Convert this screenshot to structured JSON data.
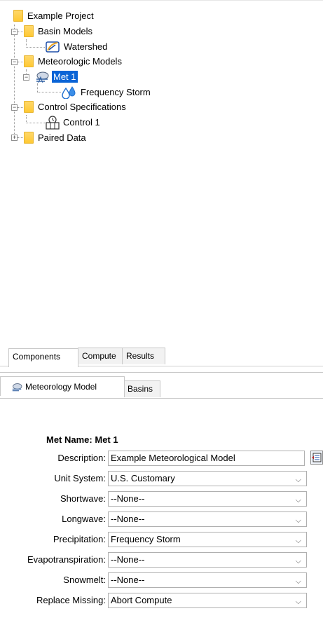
{
  "tree": {
    "root": "Example Project",
    "basin_models": "Basin Models",
    "watershed": "Watershed",
    "meteorologic_models": "Meteorologic Models",
    "met1": "Met 1",
    "frequency_storm": "Frequency Storm",
    "control_specs": "Control Specifications",
    "control1": "Control 1",
    "paired_data": "Paired Data",
    "expand_minus": "−",
    "expand_plus": "+"
  },
  "bottom_tabs": [
    "Components",
    "Compute",
    "Results"
  ],
  "detail_tabs": [
    "Meteorology Model",
    "Basins"
  ],
  "form": {
    "met_name_label": "Met Name:",
    "met_name_value": "Met 1",
    "fields": [
      {
        "label": "Description:",
        "value": "Example Meteorological Model"
      },
      {
        "label": "Unit System:",
        "value": "U.S. Customary"
      },
      {
        "label": "Shortwave:",
        "value": "--None--"
      },
      {
        "label": "Longwave:",
        "value": "--None--"
      },
      {
        "label": "Precipitation:",
        "value": "Frequency Storm"
      },
      {
        "label": "Evapotranspiration:",
        "value": "--None--"
      },
      {
        "label": "Snowmelt:",
        "value": "--None--"
      },
      {
        "label": "Replace Missing:",
        "value": "Abort Compute"
      }
    ],
    "chevron": "⌵"
  },
  "colors": {
    "selection": "#0a64d6",
    "folder": "#ffc933"
  }
}
